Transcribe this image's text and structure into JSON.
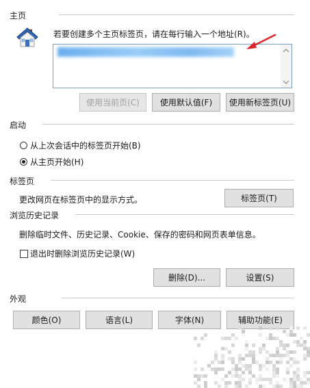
{
  "home": {
    "section_label": "主页",
    "instruction": "若要创建多个主页标签页，请在每行输入一个地址(R)。",
    "url_value": "",
    "buttons": {
      "use_current": "使用当前页(C)",
      "use_default": "使用默认值(F)",
      "use_new_tab": "使用新标签页(U)"
    }
  },
  "startup": {
    "section_label": "启动",
    "options": [
      {
        "label": "从上次会话中的标签页开始(B)",
        "checked": false
      },
      {
        "label": "从主页开始(H)",
        "checked": true
      }
    ]
  },
  "tabs": {
    "section_label": "标签页",
    "description": "更改网页在标签页中的显示方式。",
    "button": "标签页(T)"
  },
  "history": {
    "section_label": "浏览历史记录",
    "description": "删除临时文件、历史记录、Cookie、保存的密码和网页表单信息。",
    "checkbox_label": "退出时删除浏览历史记录(W)",
    "checkbox_checked": false,
    "buttons": {
      "delete": "删除(D)...",
      "settings": "设置(S)"
    }
  },
  "appearance": {
    "section_label": "外观",
    "buttons": {
      "colors": "颜色(O)",
      "languages": "语言(L)",
      "fonts": "字体(N)",
      "accessibility": "辅助功能(E)"
    }
  },
  "colors": {
    "arrow": "#d9252a",
    "focus_border": "#7a9cc6",
    "url_highlight": "#5aa6ec"
  },
  "icons": {
    "home": "house-icon",
    "arrow": "red-arrow-icon"
  }
}
